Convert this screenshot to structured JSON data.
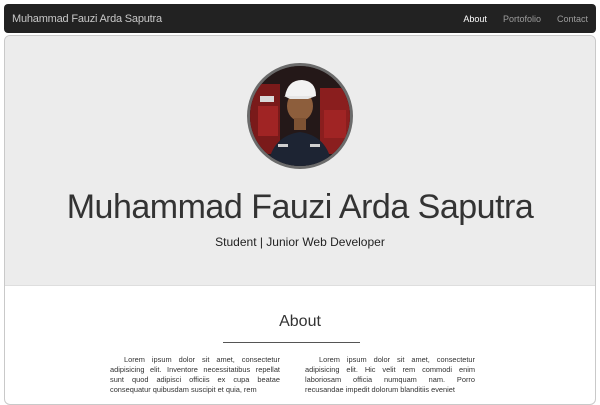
{
  "navbar": {
    "brand": "Muhammad Fauzi Arda Saputra",
    "links": [
      {
        "label": "About",
        "active": true
      },
      {
        "label": "Portofolio",
        "active": false
      },
      {
        "label": "Contact",
        "active": false
      }
    ]
  },
  "hero": {
    "name": "Muhammad Fauzi Arda Saputra",
    "tagline": "Student | Junior Web Developer"
  },
  "about": {
    "title": "About",
    "paragraph_left": "Lorem ipsum dolor sit amet, consectetur adipisicing elit. Inventore necessitatibus repellat sunt quod adipisci officiis ex cupa beatae consequatur quibusdam suscipit et quia, rem",
    "paragraph_right": "Lorem ipsum dolor sit amet, consectetur adipisicing elit. Hic velit rem commodi enim laboriosam officia numquam nam. Porro recusandae impedit dolorum blanditiis eveniet"
  }
}
